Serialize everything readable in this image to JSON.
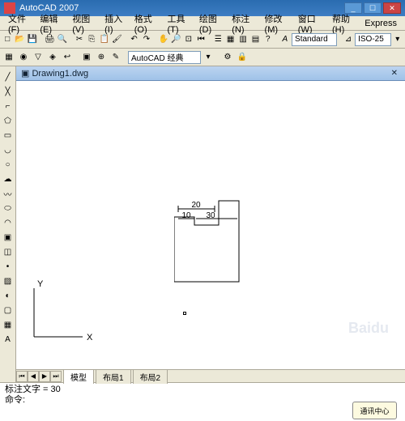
{
  "title": "AutoCAD 2007",
  "menu": [
    "文件(F)",
    "编辑(E)",
    "视图(V)",
    "插入(I)",
    "格式(O)",
    "工具(T)",
    "绘图(D)",
    "标注(N)",
    "修改(M)",
    "窗口(W)",
    "帮助(H)",
    "Express"
  ],
  "style_box": "Standard",
  "dim_box": "ISO-25",
  "workspace": "AutoCAD 经典",
  "doc_title": "Drawing1.dwg",
  "dims": {
    "d20": "20",
    "d10": "10",
    "d30": "30"
  },
  "axis": {
    "x": "X",
    "y": "Y"
  },
  "model_tabs": {
    "model": "模型",
    "layout1": "布局1",
    "layout2": "布局2"
  },
  "cmd": {
    "line1": "标注文字 = 30",
    "line2": "命令:"
  },
  "notice": "通讯中心",
  "watermark": "Baidu"
}
